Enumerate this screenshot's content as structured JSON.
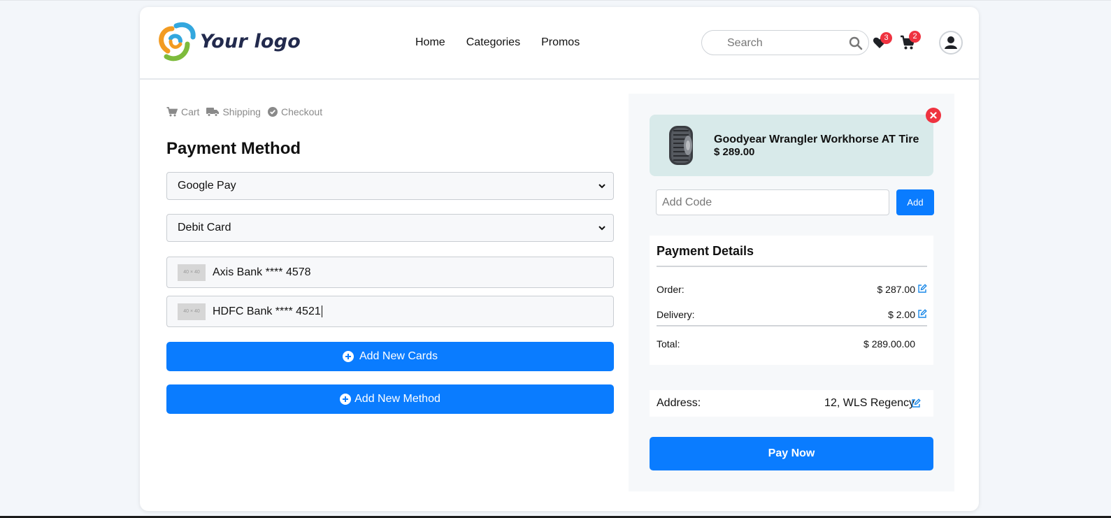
{
  "brand": {
    "logo_text": "Your logo"
  },
  "nav": {
    "items": [
      "Home",
      "Categories",
      "Promos"
    ]
  },
  "search": {
    "placeholder": "Search"
  },
  "header": {
    "wishlist_count": "3",
    "cart_count": "2"
  },
  "breadcrumb": {
    "steps": [
      "Cart",
      "Shipping",
      "Checkout"
    ]
  },
  "payment": {
    "title": "Payment Method",
    "method_selected": "Google Pay",
    "card_type_selected": "Debit Card",
    "saved_cards": [
      "Axis Bank **** 4578",
      "HDFC Bank **** 4521"
    ],
    "placeholder_text": "40 × 40",
    "add_cards_label": "Add New Cards",
    "add_method_label": "Add New Method"
  },
  "product": {
    "name": "Goodyear Wrangler Workhorse AT Tire",
    "price": "$ 289.00"
  },
  "promo": {
    "placeholder": "Add Code",
    "add_label": "Add"
  },
  "details": {
    "title": "Payment Details",
    "order_label": "Order:",
    "order_value": "$ 287.00",
    "delivery_label": "Delivery:",
    "delivery_value": "$ 2.00",
    "total_label": "Total:",
    "total_value": "$ 289.00.00"
  },
  "address": {
    "label": "Address:",
    "value": "12, WLS Regency"
  },
  "pay": {
    "label": "Pay Now"
  },
  "colors": {
    "accent": "#0a7cff",
    "badge": "#ef3340",
    "product_bg": "#d8eaea",
    "panel_bg": "#f6f8fa"
  }
}
